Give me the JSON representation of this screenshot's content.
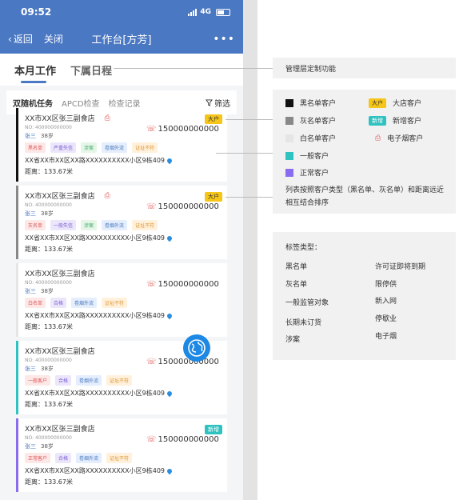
{
  "status_bar": {
    "time": "09:52",
    "network": "4G"
  },
  "nav": {
    "back": "返回",
    "close": "关闭",
    "title": "工作台[方芳]",
    "more": "•••"
  },
  "top_tabs": [
    "本月工作",
    "下属日程"
  ],
  "sub_tabs": [
    "双随机任务",
    "APCD检查",
    "检查记录"
  ],
  "filter": "筛选",
  "cards": [
    {
      "name": "XX市XX区张三副食店",
      "no": "NO: 400000000000",
      "person": "张三",
      "age": "38岁",
      "phone": "150000000000",
      "tags": [
        "黑名单",
        "严重失信",
        "涉案",
        "卷烟外流",
        "证址不符"
      ],
      "address": "XX省XX市XX区XX路XXXXXXXXXX小区9栋409",
      "distance": "距离：133.67米",
      "badge": "大户"
    },
    {
      "name": "XX市XX区张三副食店",
      "no": "NO: 400000000000",
      "person": "张三",
      "age": "38岁",
      "phone": "150000000000",
      "tags": [
        "灰名单",
        "一般失信",
        "涉案",
        "卷烟外流",
        "证址不符"
      ],
      "address": "XX省XX市XX区XX路XXXXXXXXXX小区9栋409",
      "distance": "距离：133.67米",
      "badge": "大户"
    },
    {
      "name": "XX市XX区张三副食店",
      "no": "NO: 400000000000",
      "person": "张三",
      "age": "38岁",
      "phone": "150000000000",
      "tags": [
        "白名单",
        "合格",
        "卷烟外流",
        "证址不符"
      ],
      "address": "XX省XX市XX区XX路XXXXXXXXXX小区9栋409",
      "distance": "距离：133.67米",
      "badge": ""
    },
    {
      "name": "XX市XX区张三副食店",
      "no": "NO: 400000000000",
      "person": "张三",
      "age": "38岁",
      "phone": "150000000000",
      "tags": [
        "一般客户",
        "合格",
        "卷烟外流",
        "证址不符"
      ],
      "address": "XX省XX市XX区XX路XXXXXXXXXX小区9栋409",
      "distance": "距离：133.67米",
      "badge": ""
    },
    {
      "name": "XX市XX区张三副食店",
      "no": "NO: 400000000000",
      "person": "张三",
      "age": "38岁",
      "phone": "150000000000",
      "tags": [
        "正常客户",
        "合格",
        "卷烟外流",
        "证址不符"
      ],
      "address": "XX省XX市XX区XX路XXXXXXXXXX小区9栋409",
      "distance": "距离：133.67米",
      "badge": "新增"
    }
  ],
  "annotations": {
    "a1": "管理层定制功能",
    "legend": {
      "black": "黑名单客户",
      "grey": "灰名单客户",
      "white": "白名单客户",
      "normal": "一般客户",
      "regular": "正常客户",
      "big_badge": "大户",
      "big": "大店客户",
      "new_badge": "新增",
      "new": "新增客户",
      "ecig": "电子烟客户"
    },
    "note": "列表按照客户类型（黑名单、灰名单）和距离远近相互结合排序",
    "tag_types_title": "标签类型：",
    "tag_types": [
      "黑名单",
      "许可证即将到期",
      "灰名单",
      "限停供",
      "一般监管对象",
      "新入网",
      "长期未订货",
      "停歇业",
      "涉案",
      "电子烟"
    ]
  },
  "colors": {
    "primary": "#4a78c2",
    "black": "#111111",
    "grey": "#888888",
    "white": "#e5e5e5",
    "normal": "#30c2c0",
    "regular": "#8a6cf0",
    "big": "#f5c518"
  }
}
